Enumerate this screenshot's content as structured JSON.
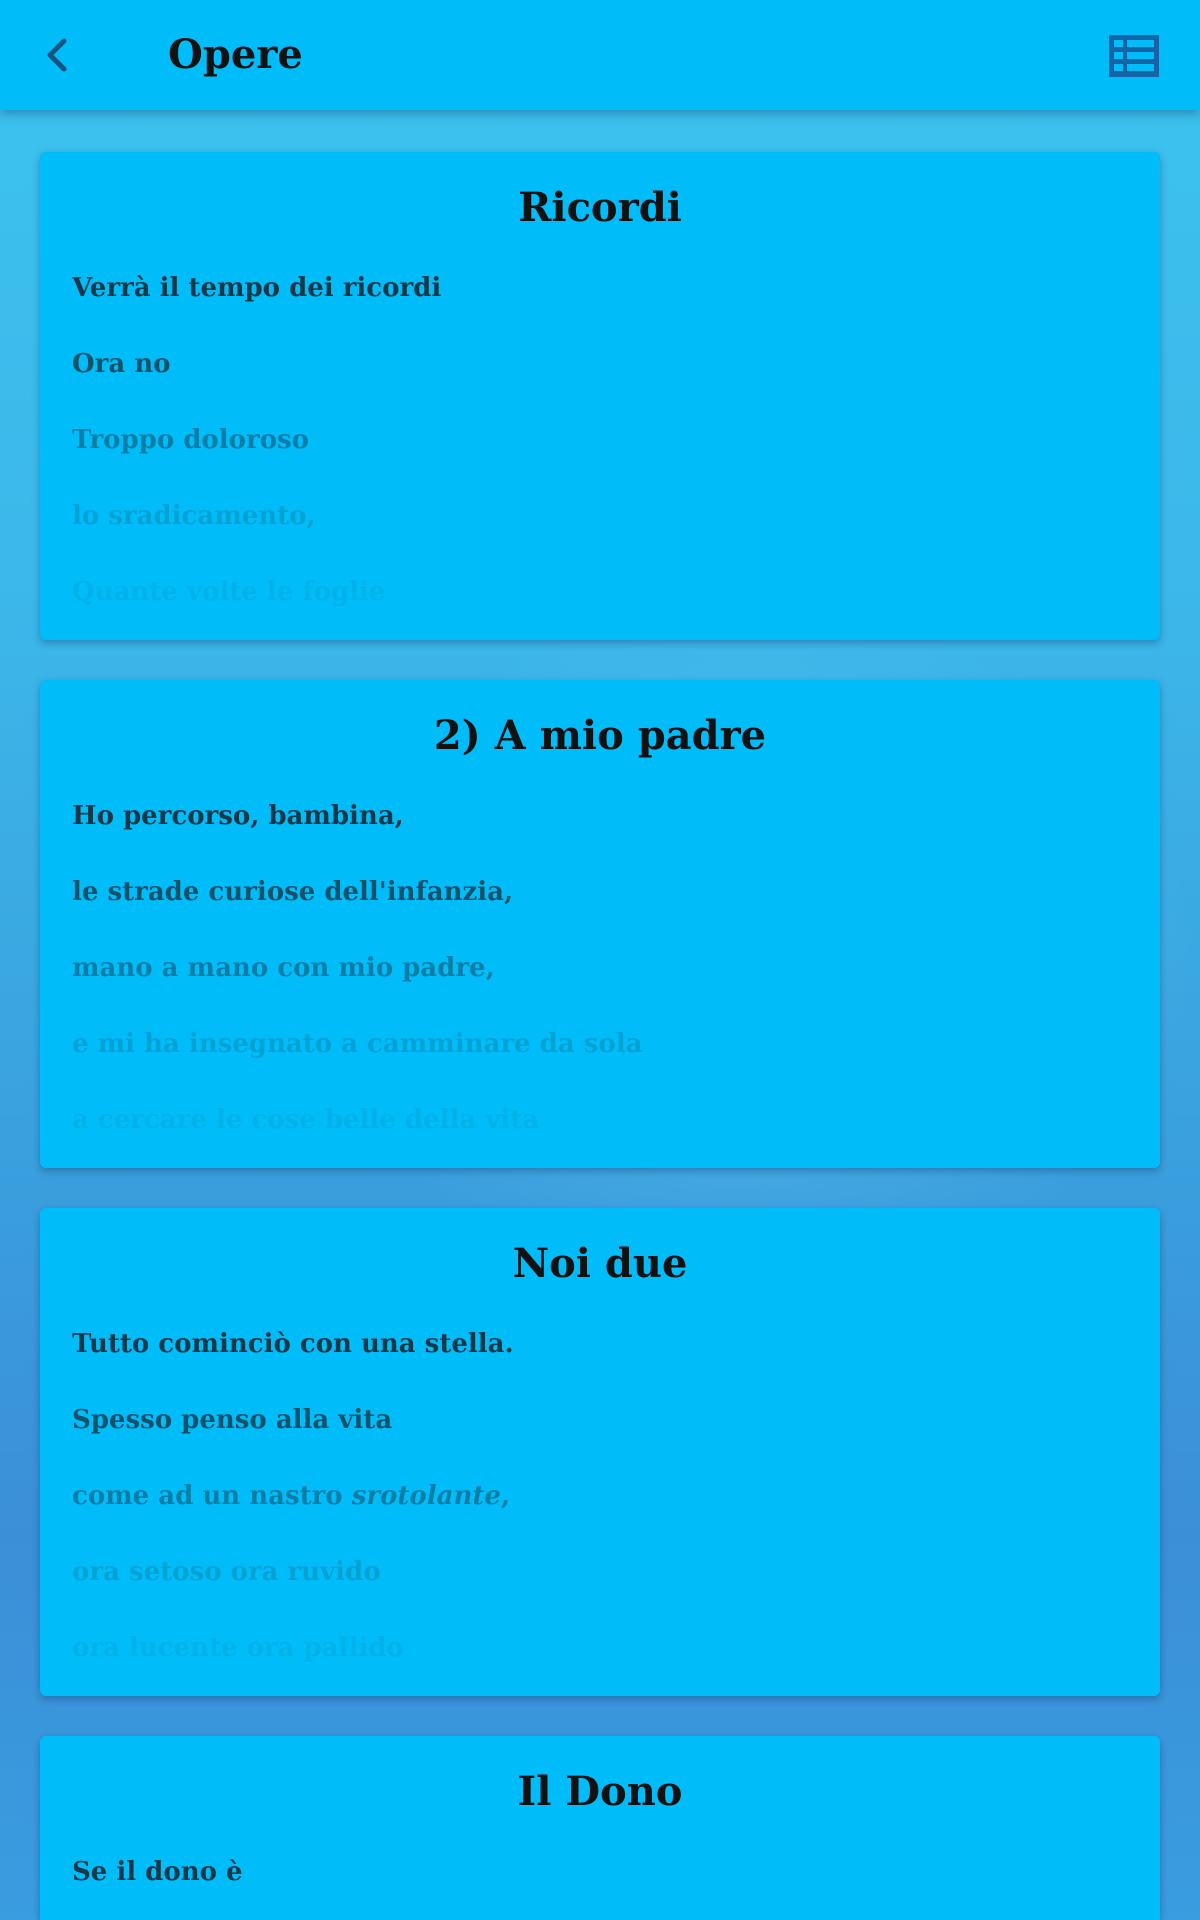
{
  "header": {
    "title": "Opere",
    "back_icon": "chevron-left-icon",
    "menu_icon": "list-icon"
  },
  "colors": {
    "primary": "#00bcf9",
    "text": "#121212",
    "icon": "#1565a6"
  },
  "poems": [
    {
      "title": "Ricordi",
      "lines": [
        "Verrà il tempo dei ricordi",
        "Ora no",
        "Troppo doloroso",
        "lo sradicamento,",
        "Quante volte le foglie"
      ]
    },
    {
      "title": "2) A mio padre",
      "lines": [
        "Ho percorso, bambina,",
        "le strade curiose dell'infanzia,",
        "mano a mano con mio padre,",
        "e mi ha insegnato a camminare da sola",
        "a cercare le cose belle della vita"
      ]
    },
    {
      "title": "Noi due",
      "lines": [
        "Tutto cominciò con una stella.",
        "Spesso penso alla vita",
        "come ad un nastro ",
        "ora setoso ora ruvido",
        "ora lucente ora pallido"
      ],
      "line3_italic": "srotolante",
      "line3_end": ","
    },
    {
      "title": "Il Dono",
      "lines": [
        "Se il dono è"
      ]
    }
  ]
}
